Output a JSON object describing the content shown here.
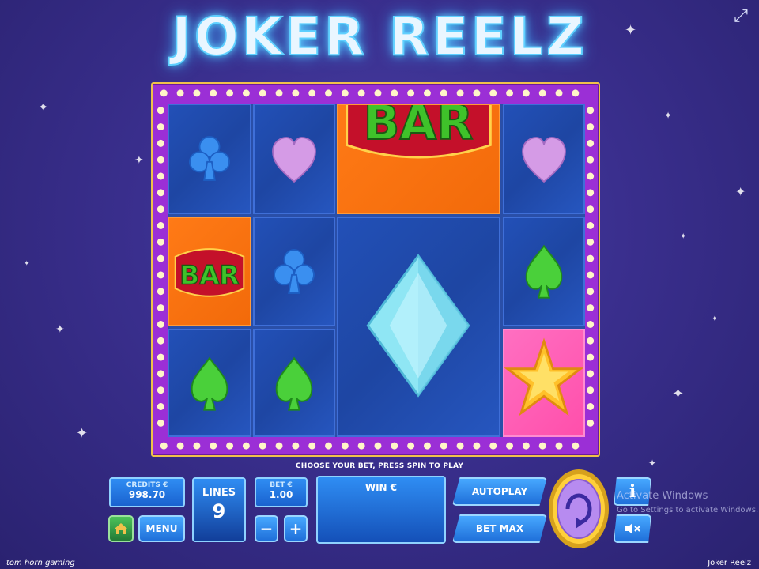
{
  "title": "JOKER REELZ",
  "reels": {
    "symbols": {
      "club": "club-icon",
      "heart": "heart-icon",
      "spade": "spade-icon",
      "bar": "bar-symbol",
      "diamond": "diamond-icon",
      "star": "star-icon"
    },
    "bar_label": "BAR",
    "colors": {
      "club": "#3a8ff0",
      "heart": "#d59be6",
      "spade": "#4ad03a",
      "diamond": "#8fe6f4",
      "star": "#ffc12a",
      "bar_text": "#3fc22a",
      "bar_plate": "#c4102a"
    }
  },
  "instructions": "CHOOSE YOUR BET, PRESS SPIN TO PLAY",
  "credits": {
    "label": "CREDITS €",
    "value": "998.70"
  },
  "lines": {
    "label": "LINES",
    "value": "9"
  },
  "bet": {
    "label": "BET €",
    "value": "1.00",
    "minus": "−",
    "plus": "+"
  },
  "win": {
    "label": "WIN €"
  },
  "buttons": {
    "menu": "MENU",
    "autoplay": "AUTOPLAY",
    "bet_max": "BET MAX",
    "info": "i",
    "home": "home-icon",
    "sound": "speaker-mute-icon",
    "spin": "spin-icon",
    "fullscreen": "fullscreen-icon"
  },
  "watermark": {
    "line1": "Activate Windows",
    "line2": "Go to Settings to activate Windows."
  },
  "footer": {
    "brand": "tom horn gaming",
    "game": "Joker Reelz"
  }
}
